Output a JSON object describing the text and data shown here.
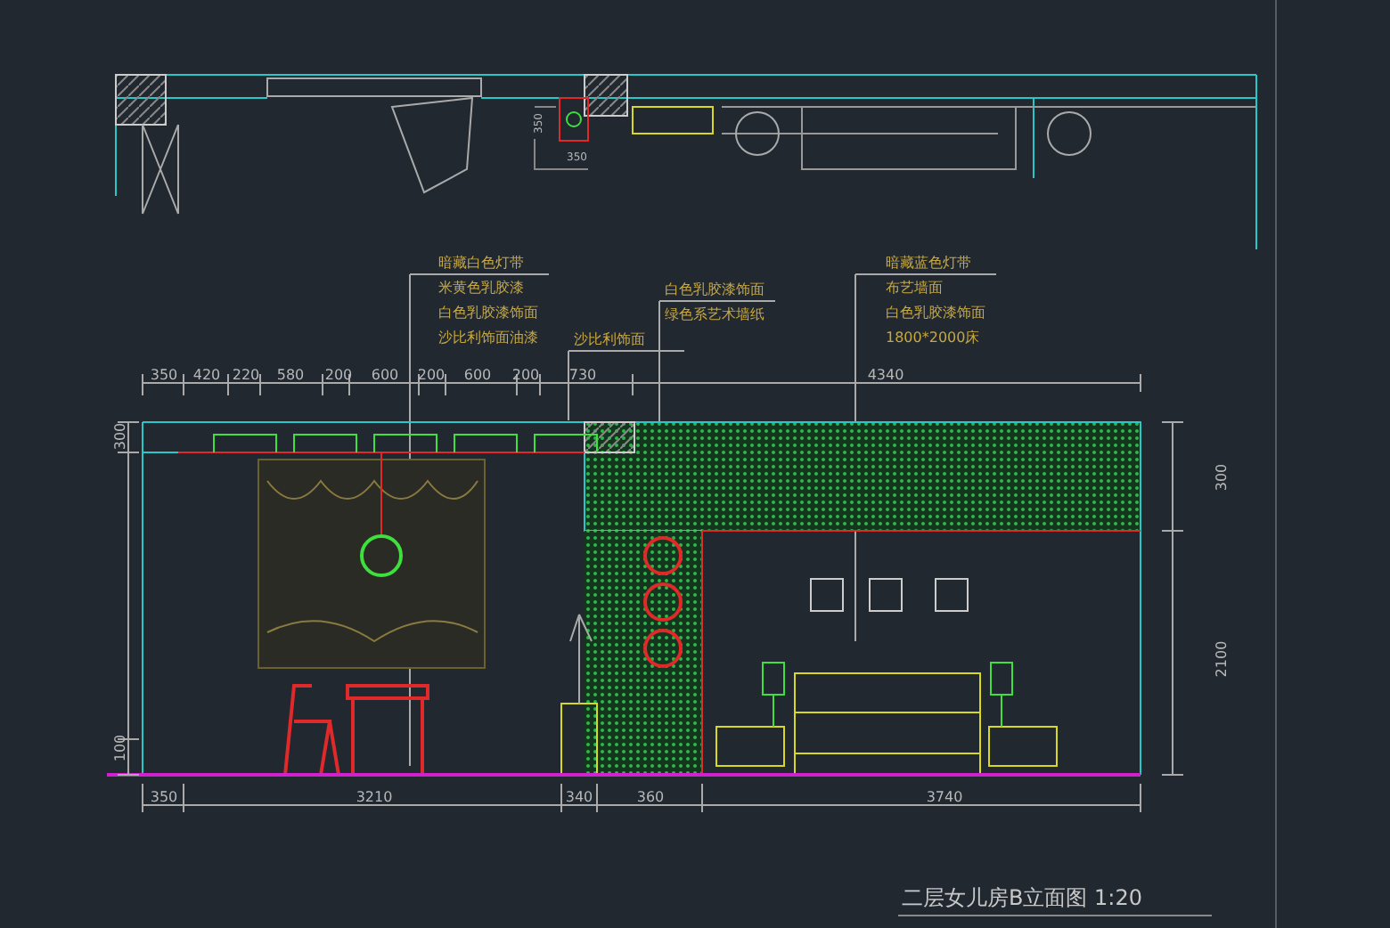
{
  "plan": {
    "labels": [
      "350",
      "350"
    ]
  },
  "notes": [
    {
      "lines": [
        "暗藏白色灯带",
        "米黄色乳胶漆",
        "白色乳胶漆饰面",
        "沙比利饰面油漆"
      ]
    },
    {
      "lines": [
        "沙比利饰面"
      ]
    },
    {
      "lines": [
        "白色乳胶漆饰面",
        "绿色系艺术墙纸"
      ]
    },
    {
      "lines": [
        "暗藏蓝色灯带",
        "布艺墙面",
        "白色乳胶漆饰面",
        "1800*2000床"
      ]
    }
  ],
  "top_dimensions": [
    "350",
    "420",
    "220",
    "580",
    "200",
    "600",
    "200",
    "600",
    "200",
    "730"
  ],
  "overall_dimension": "4340",
  "left_heights": [
    "300",
    "100"
  ],
  "right_heights": [
    "300",
    "2100"
  ],
  "bottom_dimensions": [
    "350",
    "3210",
    "340",
    "360",
    "3740"
  ],
  "title": "二层女儿房B立面图 1:20"
}
